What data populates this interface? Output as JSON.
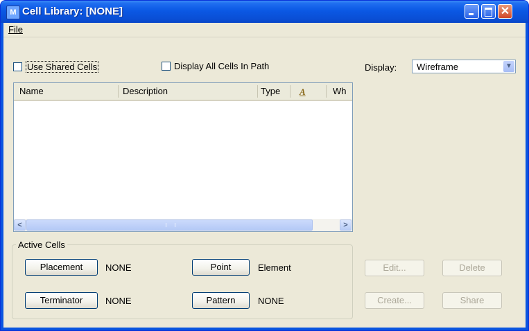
{
  "window": {
    "title": "Cell Library: [NONE]",
    "app_icon": "microstation-icon",
    "controls": {
      "minimize": "minimize-icon",
      "maximize": "maximize-icon",
      "close": "close-icon"
    }
  },
  "menubar": {
    "file": "File"
  },
  "options": {
    "use_shared_cells": {
      "label": "Use Shared Cells",
      "checked": false
    },
    "display_all_cells": {
      "label": "Display All Cells In Path",
      "checked": false
    }
  },
  "display": {
    "label": "Display:",
    "value": "Wireframe"
  },
  "cell_list": {
    "columns": [
      "Name",
      "Description",
      "Type",
      "Wh"
    ],
    "rows": []
  },
  "active_cells": {
    "title": "Active Cells",
    "placement": {
      "button": "Placement",
      "value": "NONE"
    },
    "point": {
      "button": "Point",
      "value": "Element"
    },
    "terminator": {
      "button": "Terminator",
      "value": "NONE"
    },
    "pattern": {
      "button": "Pattern",
      "value": "NONE"
    }
  },
  "actions": {
    "edit": "Edit...",
    "delete": "Delete",
    "create": "Create...",
    "share": "Share"
  },
  "colors": {
    "titlebar": "#0a55e0",
    "dialog_bg": "#ece9d8",
    "disabled_text": "#aca899"
  }
}
